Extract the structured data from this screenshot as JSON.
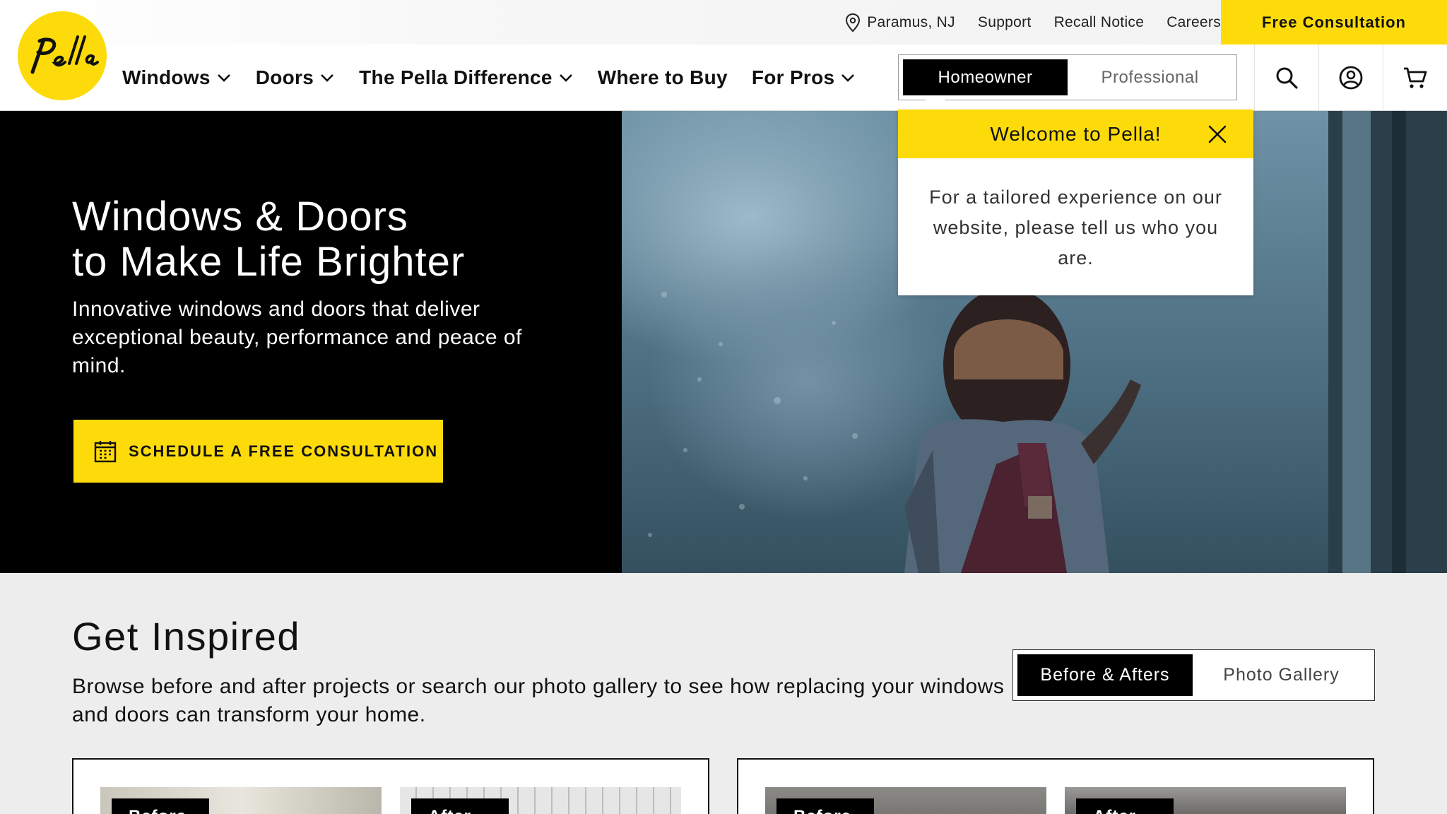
{
  "utility": {
    "location": "Paramus, NJ",
    "links": [
      "Support",
      "Recall Notice",
      "Careers"
    ],
    "cta": "Free Consultation"
  },
  "brand": {
    "logo_text": "Pella",
    "accent": "#fddb0a"
  },
  "nav": {
    "items": [
      {
        "label": "Windows",
        "dropdown": true
      },
      {
        "label": "Doors",
        "dropdown": true
      },
      {
        "label": "The Pella Difference",
        "dropdown": true
      },
      {
        "label": "Where to Buy",
        "dropdown": false
      },
      {
        "label": "For Pros",
        "dropdown": true
      }
    ],
    "toggle": {
      "active": "Homeowner",
      "inactive": "Professional"
    },
    "icons": [
      "search-icon",
      "account-icon",
      "cart-icon"
    ]
  },
  "welcome": {
    "title": "Welcome to Pella!",
    "body": "For a tailored experience on our website, please tell us who you are."
  },
  "hero": {
    "title_line1": "Windows & Doors",
    "title_line2": "to Make Life Brighter",
    "subtitle": "Innovative windows and doors that deliver exceptional beauty, performance and peace of mind.",
    "cta": "SCHEDULE A FREE CONSULTATION"
  },
  "inspired": {
    "title": "Get Inspired",
    "description": "Browse before and after projects or search our photo gallery to see how replacing your windows and doors can transform your home.",
    "tabs": {
      "active": "Before & Afters",
      "inactive": "Photo Gallery"
    },
    "cards": [
      {
        "before": "Before",
        "after": "After"
      },
      {
        "before": "Before",
        "after": "After"
      }
    ]
  }
}
